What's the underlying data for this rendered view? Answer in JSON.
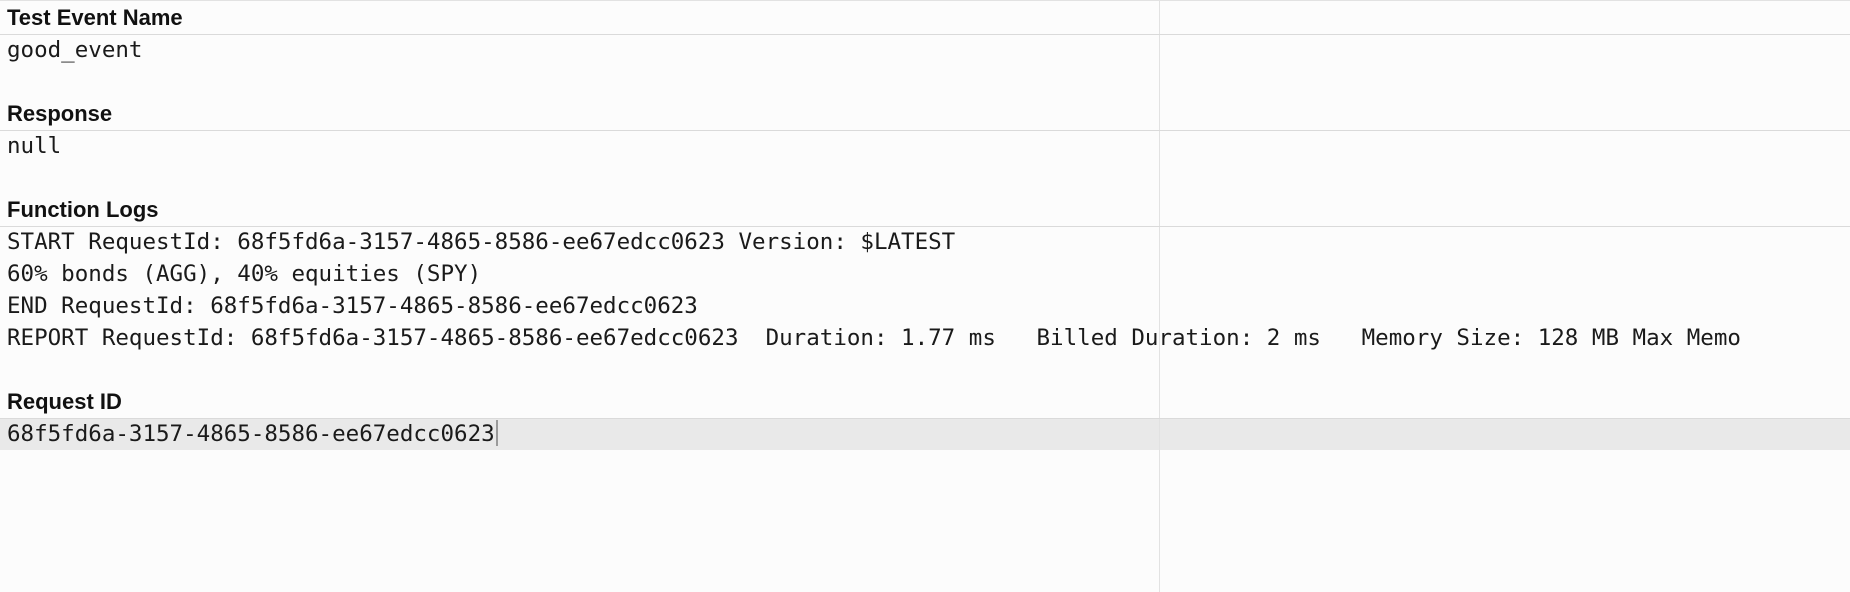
{
  "sections": {
    "test_event_name": {
      "label": "Test Event Name",
      "value": "good_event"
    },
    "response": {
      "label": "Response",
      "value": "null"
    },
    "function_logs": {
      "label": "Function Logs",
      "lines": [
        "START RequestId: 68f5fd6a-3157-4865-8586-ee67edcc0623 Version: $LATEST",
        "60% bonds (AGG), 40% equities (SPY)",
        "END RequestId: 68f5fd6a-3157-4865-8586-ee67edcc0623",
        "REPORT RequestId: 68f5fd6a-3157-4865-8586-ee67edcc0623  Duration: 1.77 ms   Billed Duration: 2 ms   Memory Size: 128 MB Max Memo"
      ]
    },
    "request_id": {
      "label": "Request ID",
      "value": "68f5fd6a-3157-4865-8586-ee67edcc0623"
    }
  }
}
